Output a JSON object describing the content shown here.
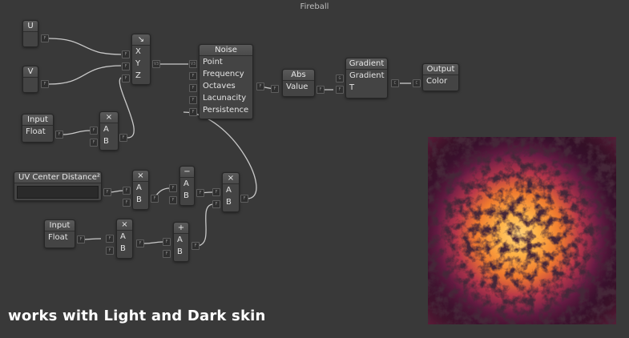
{
  "window": {
    "title": "Fireball"
  },
  "nodes": {
    "u": {
      "header": "U",
      "out": "F"
    },
    "v": {
      "header": "V",
      "out": "F"
    },
    "vec3": {
      "header": "↘",
      "rows": [
        "X",
        "Y",
        "Z"
      ],
      "in": [
        "F",
        "F",
        "F"
      ],
      "out": "V3"
    },
    "input1": {
      "header": "Input",
      "field": "Float",
      "out": "F"
    },
    "mul1": {
      "header": "×",
      "rows": [
        "A",
        "B"
      ],
      "in": [
        "F",
        "F"
      ],
      "out": "F"
    },
    "noise": {
      "header": "Noise",
      "rows": [
        "Point",
        "Frequency",
        "Octaves",
        "Lacunacity",
        "Persistence"
      ],
      "in": [
        "V3",
        "F",
        "F",
        "F",
        "F"
      ],
      "out": "F"
    },
    "abs": {
      "header": "Abs",
      "rows": [
        "Value"
      ],
      "in": [
        "F"
      ],
      "out": "F"
    },
    "gradient": {
      "header": "Gradient",
      "rows": [
        "Gradient",
        "T"
      ],
      "in": [
        "G",
        "F"
      ],
      "out": "C"
    },
    "output": {
      "header": "Output",
      "rows": [
        "Color"
      ],
      "in": [
        "C"
      ]
    },
    "uvdist": {
      "header": "UV Center Distance²",
      "out": "F"
    },
    "mul2": {
      "header": "×",
      "rows": [
        "A",
        "B"
      ],
      "in": [
        "F",
        "F"
      ],
      "out": "F"
    },
    "sub": {
      "header": "−",
      "rows": [
        "A",
        "B"
      ],
      "in": [
        "F",
        "F"
      ],
      "out": "F"
    },
    "mul3": {
      "header": "×",
      "rows": [
        "A",
        "B"
      ],
      "in": [
        "F",
        "F"
      ],
      "out": "F"
    },
    "input2": {
      "header": "Input",
      "field": "Float",
      "out": "F"
    },
    "mul4": {
      "header": "×",
      "rows": [
        "A",
        "B"
      ],
      "in": [
        "F",
        "F"
      ],
      "out": "F"
    },
    "add": {
      "header": "+",
      "rows": [
        "A",
        "B"
      ],
      "in": [
        "F",
        "F"
      ],
      "out": "F"
    }
  },
  "caption": "works with Light and Dark skin",
  "colors": {
    "background": "#393939",
    "node": "#444444",
    "wire": "#c8c8c8",
    "fire_core": "#ffb347",
    "fire_edge": "#1a0a10"
  }
}
